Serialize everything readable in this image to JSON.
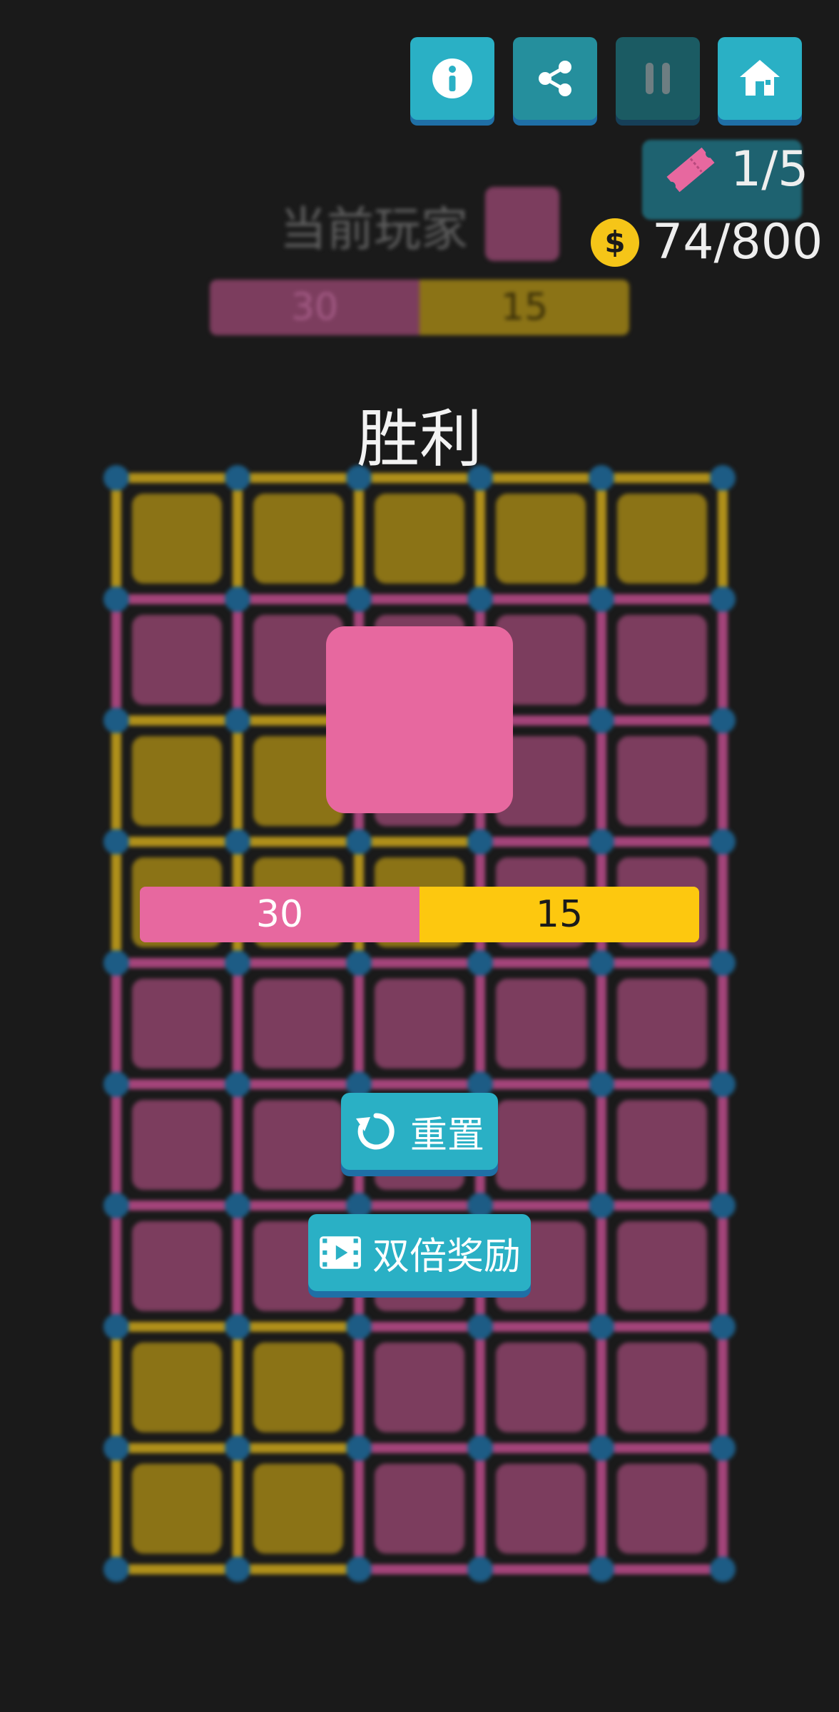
{
  "toolbar": {
    "info_icon": "info-icon",
    "share_icon": "share-icon",
    "pause_icon": "pause-icon",
    "home_icon": "home-icon",
    "colors": {
      "accent": "#2ab0c5",
      "share": "#258f9d",
      "pause": "#1b5b63"
    }
  },
  "resources": {
    "tickets": "1/5",
    "coins": "74/800",
    "ticket_icon": "ticket-icon",
    "coin_icon": "coin-icon"
  },
  "background": {
    "current_player_label": "当前玩家",
    "score_pink": "30",
    "score_yellow": "15"
  },
  "result": {
    "title": "胜利",
    "score_pink": "30",
    "score_yellow": "15",
    "pink_share": 0.5
  },
  "buttons": {
    "reset_label": "重置",
    "double_reward_label": "双倍奖励"
  },
  "board": {
    "rows": 9,
    "cols": 5,
    "colors": {
      "pink": "#7c3d5e",
      "yellow": "#8b7316",
      "dot": "#1d5c85",
      "line_pink": "#a4447a",
      "line_yellow": "#b0901a"
    },
    "cells": [
      [
        "Y",
        "Y",
        "Y",
        "Y",
        "Y"
      ],
      [
        "P",
        "P",
        "P",
        "P",
        "P"
      ],
      [
        "Y",
        "Y",
        "P",
        "P",
        "P"
      ],
      [
        "Y",
        "Y",
        "Y",
        "P",
        "P"
      ],
      [
        "P",
        "P",
        "P",
        "P",
        "P"
      ],
      [
        "P",
        "P",
        "P",
        "P",
        "P"
      ],
      [
        "P",
        "P",
        "P",
        "P",
        "P"
      ],
      [
        "Y",
        "Y",
        "P",
        "P",
        "P"
      ],
      [
        "Y",
        "Y",
        "P",
        "P",
        "P"
      ]
    ]
  }
}
